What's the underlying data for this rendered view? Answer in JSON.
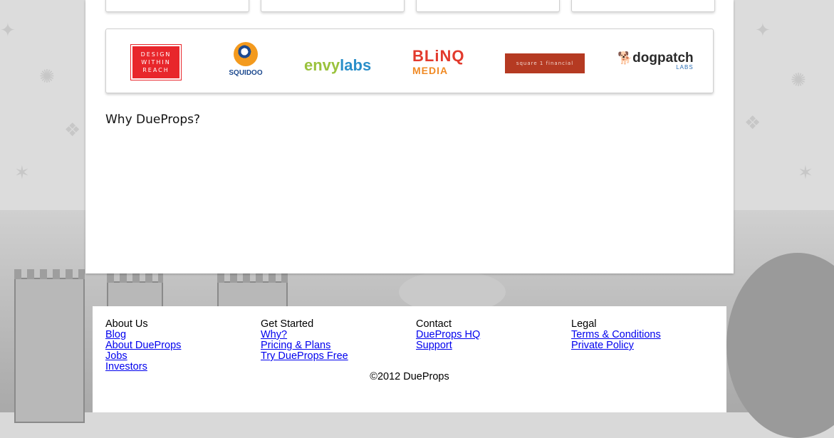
{
  "partners": {
    "design_within_reach": "DESIGN WITHIN REACH",
    "squidoo": "SQUIDOO",
    "envylabs_a": "envy",
    "envylabs_b": "labs",
    "blinq_1": "BLiNQ",
    "blinq_2": "MEDIA",
    "square1": "square 1 financial",
    "dogpatch_1": "dogpatch",
    "dogpatch_2": "LABS"
  },
  "why": {
    "title": "Why DueProps?"
  },
  "footer": {
    "about": {
      "heading": "About Us",
      "links": [
        "Blog",
        "About DueProps",
        "Jobs",
        "Investors"
      ]
    },
    "get_started": {
      "heading": "Get Started",
      "links": [
        "Why?",
        "Pricing & Plans",
        "Try DueProps Free"
      ]
    },
    "contact": {
      "heading": "Contact",
      "links": [
        "DueProps HQ",
        "Support"
      ]
    },
    "legal": {
      "heading": "Legal",
      "links": [
        "Terms & Conditions",
        "Private Policy"
      ]
    },
    "copyright": "©2012 DueProps"
  },
  "colors": {
    "link": "#0000ee",
    "dwr_red": "#e8262b",
    "envy_green": "#9ac23c",
    "envy_blue": "#2b8fc9",
    "blinq_red": "#e23a2d",
    "blinq_orange": "#f08a24",
    "square1_red": "#b53a22"
  }
}
